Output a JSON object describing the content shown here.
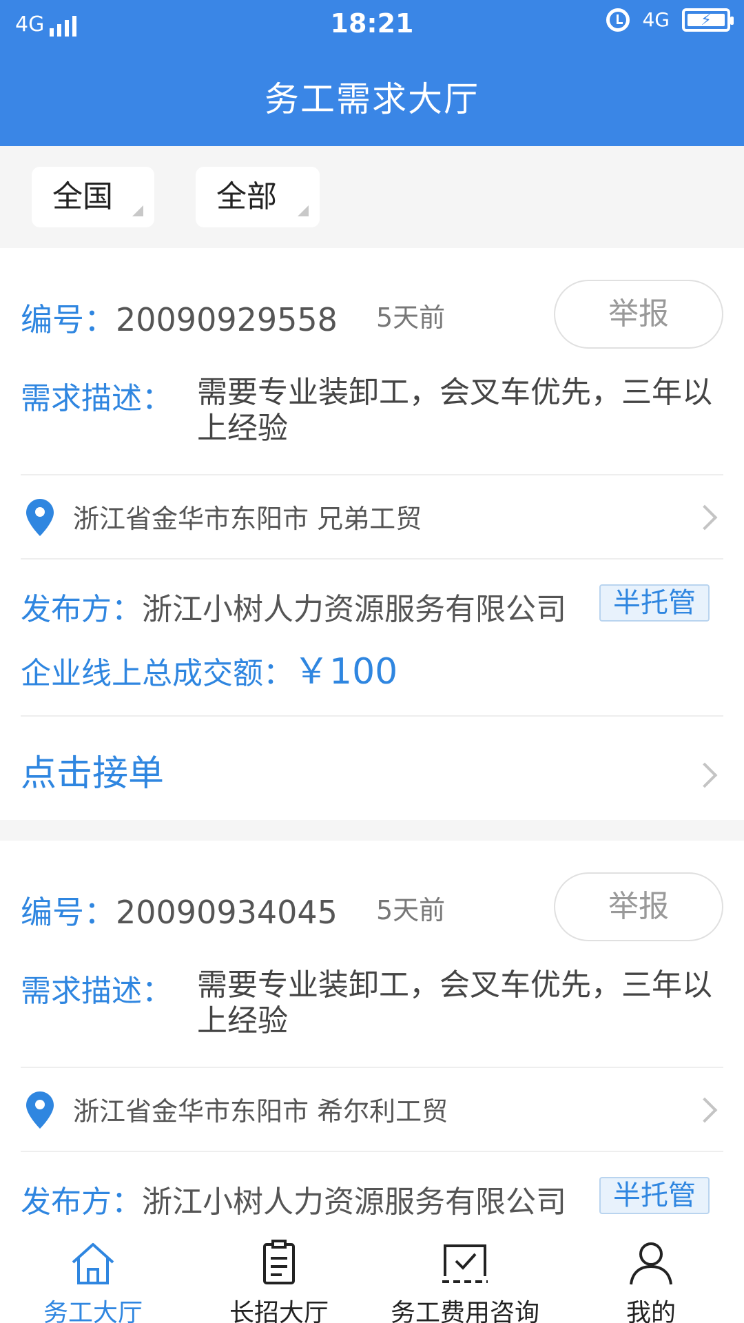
{
  "status_bar": {
    "network_left": "4G",
    "time": "18:21",
    "network_right": "4G",
    "battery_icon": "battery-charging-icon"
  },
  "header": {
    "title": "务工需求大厅"
  },
  "filters": {
    "region": "全国",
    "category": "全部"
  },
  "cards": [
    {
      "id_label": "编号：",
      "id_value": "20090929558",
      "ago": "5天前",
      "report_label": "举报",
      "desc_label": "需求描述：",
      "desc_text": "需要专业装卸工，会叉车优先，三年以上经验",
      "location": "浙江省金华市东阳市 兄弟工贸",
      "publisher_label": "发布方：",
      "publisher": "浙江小树人力资源服务有限公司",
      "badge": "半托管",
      "amount_label": "企业线上总成交额：",
      "amount_value": "￥100",
      "take_order": "点击接单"
    },
    {
      "id_label": "编号：",
      "id_value": "20090934045",
      "ago": "5天前",
      "report_label": "举报",
      "desc_label": "需求描述：",
      "desc_text": "需要专业装卸工，会叉车优先，三年以上经验",
      "location": "浙江省金华市东阳市 希尔利工贸",
      "publisher_label": "发布方：",
      "publisher": "浙江小树人力资源服务有限公司",
      "badge": "半托管"
    }
  ],
  "bottom_nav": [
    {
      "label": "务工大厅",
      "icon": "home-icon",
      "active": true
    },
    {
      "label": "长招大厅",
      "icon": "document-icon",
      "active": false
    },
    {
      "label": "务工费用咨询",
      "icon": "checked-box-icon",
      "active": false
    },
    {
      "label": "我的",
      "icon": "person-icon",
      "active": false
    }
  ],
  "colors": {
    "primary": "#3a86e6",
    "accent_text": "#2f86e0"
  }
}
